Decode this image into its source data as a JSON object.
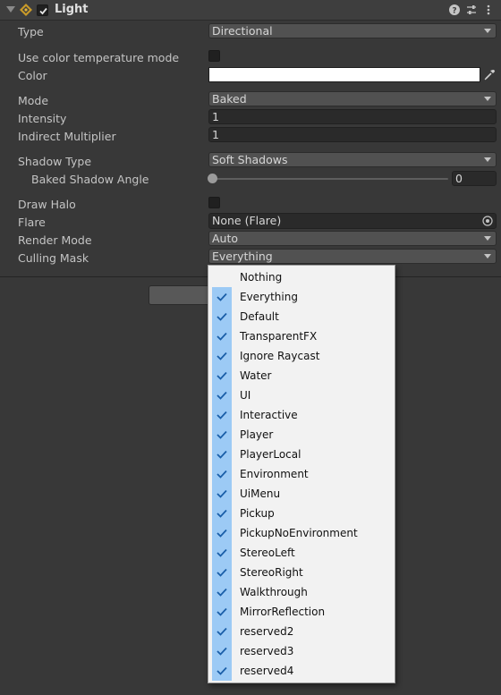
{
  "component": {
    "title": "Light",
    "enabled": true,
    "icons": [
      "light-component-icon",
      "help-icon",
      "preset-icon",
      "more-options-icon"
    ]
  },
  "fields": {
    "type": {
      "label": "Type",
      "value": "Directional"
    },
    "use_color_temperature": {
      "label": "Use color temperature mode",
      "checked": false
    },
    "color": {
      "label": "Color",
      "value": "#ffffff"
    },
    "mode": {
      "label": "Mode",
      "value": "Baked"
    },
    "intensity": {
      "label": "Intensity",
      "value": "1"
    },
    "indirect_multiplier": {
      "label": "Indirect Multiplier",
      "value": "1"
    },
    "shadow_type": {
      "label": "Shadow Type",
      "value": "Soft Shadows"
    },
    "baked_shadow_angle": {
      "label": "Baked Shadow Angle",
      "value": "0"
    },
    "draw_halo": {
      "label": "Draw Halo",
      "checked": false
    },
    "flare": {
      "label": "Flare",
      "value": "None (Flare)"
    },
    "render_mode": {
      "label": "Render Mode",
      "value": "Auto"
    },
    "culling_mask": {
      "label": "Culling Mask",
      "value": "Everything"
    }
  },
  "culling_menu": {
    "items": [
      {
        "label": "Nothing",
        "checked": false
      },
      {
        "label": "Everything",
        "checked": true
      },
      {
        "label": "Default",
        "checked": true
      },
      {
        "label": "TransparentFX",
        "checked": true
      },
      {
        "label": "Ignore Raycast",
        "checked": true
      },
      {
        "label": "Water",
        "checked": true
      },
      {
        "label": "UI",
        "checked": true
      },
      {
        "label": "Interactive",
        "checked": true
      },
      {
        "label": "Player",
        "checked": true
      },
      {
        "label": "PlayerLocal",
        "checked": true
      },
      {
        "label": "Environment",
        "checked": true
      },
      {
        "label": "UiMenu",
        "checked": true
      },
      {
        "label": "Pickup",
        "checked": true
      },
      {
        "label": "PickupNoEnvironment",
        "checked": true
      },
      {
        "label": "StereoLeft",
        "checked": true
      },
      {
        "label": "StereoRight",
        "checked": true
      },
      {
        "label": "Walkthrough",
        "checked": true
      },
      {
        "label": "MirrorReflection",
        "checked": true
      },
      {
        "label": "reserved2",
        "checked": true
      },
      {
        "label": "reserved3",
        "checked": true
      },
      {
        "label": "reserved4",
        "checked": true
      }
    ]
  },
  "colors": {
    "background": "#383838",
    "menu_check_bg": "#9ccaf5",
    "check_mark": "#1a5ea8"
  }
}
